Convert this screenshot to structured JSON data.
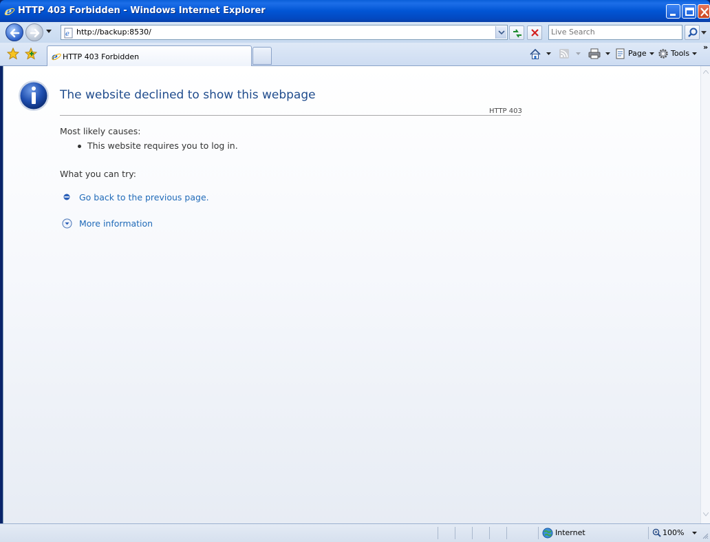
{
  "window": {
    "title": "HTTP 403 Forbidden - Windows Internet Explorer"
  },
  "address_bar": {
    "url": "http://backup:8530/",
    "search_placeholder": "Live Search"
  },
  "tabs": [
    {
      "label": "HTTP 403 Forbidden",
      "active": true
    }
  ],
  "command_bar": {
    "page_label": "Page",
    "tools_label": "Tools",
    "overflow": "»"
  },
  "page": {
    "title": "The website declined to show this webpage",
    "code": "HTTP 403",
    "causes_heading": "Most likely causes:",
    "causes": [
      "This website requires you to log in."
    ],
    "try_heading": "What you can try:",
    "try_link": "Go back to the previous page.",
    "more_info": "More information"
  },
  "status_bar": {
    "zone": "Internet",
    "zoom": "100%"
  },
  "colors": {
    "title_bar": "#0155d4",
    "link": "#1f6ab8",
    "heading": "#1f4b8c"
  }
}
